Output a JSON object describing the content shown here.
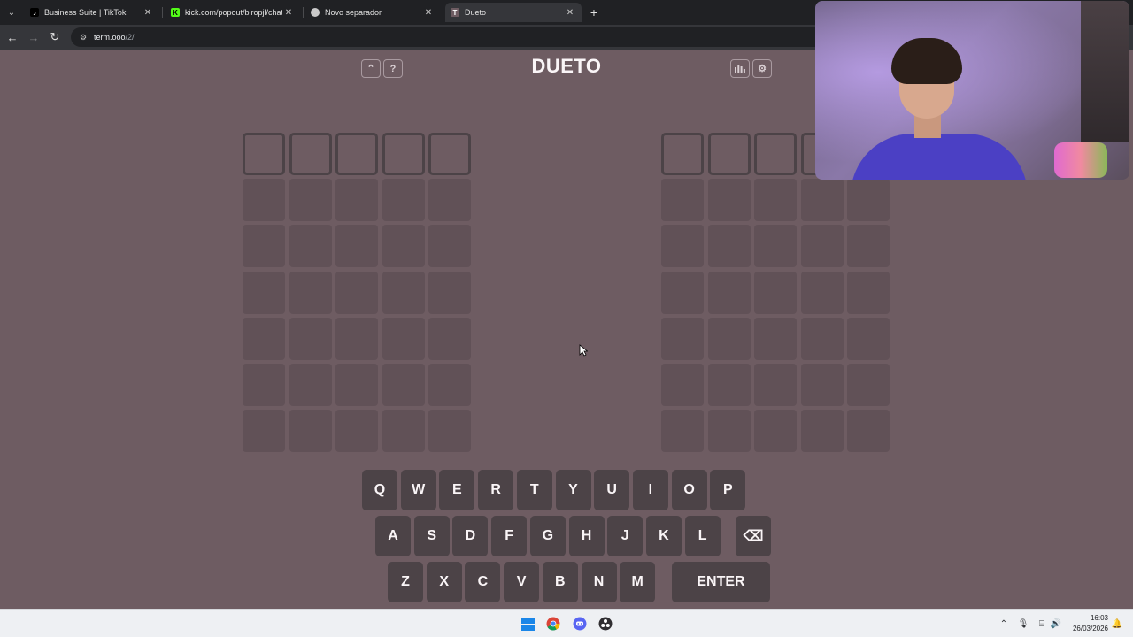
{
  "browser": {
    "tabs": [
      {
        "label": "Business Suite | TikTok",
        "favicon": "tiktok-icon",
        "active": false
      },
      {
        "label": "kick.com/popout/biropjl/chat",
        "favicon": "kick-icon",
        "active": false
      },
      {
        "label": "Novo separador",
        "favicon": "chrome-icon",
        "active": false
      },
      {
        "label": "Dueto",
        "favicon": "term-icon",
        "active": true
      }
    ],
    "close_glyph": "✕",
    "new_tab_glyph": "+",
    "url_host": "term.ooo",
    "url_path": "/2/"
  },
  "game": {
    "title": "DUETO",
    "help_glyph": "?",
    "collapse_glyph": "⌃",
    "rows": 7,
    "cols": 5
  },
  "keyboard": {
    "row1": [
      "Q",
      "W",
      "E",
      "R",
      "T",
      "Y",
      "U",
      "I",
      "O",
      "P"
    ],
    "row2": [
      "A",
      "S",
      "D",
      "F",
      "G",
      "H",
      "J",
      "K",
      "L"
    ],
    "row3": [
      "Z",
      "X",
      "C",
      "V",
      "B",
      "N",
      "M"
    ],
    "backspace_glyph": "⌫",
    "enter_label": "ENTER"
  },
  "taskbar": {
    "time": "16:03",
    "date": "26/03/2026"
  },
  "colors": {
    "background": "#6e5c62",
    "cell": "#615157",
    "key": "#4c4347",
    "text": "#faf5f7"
  }
}
